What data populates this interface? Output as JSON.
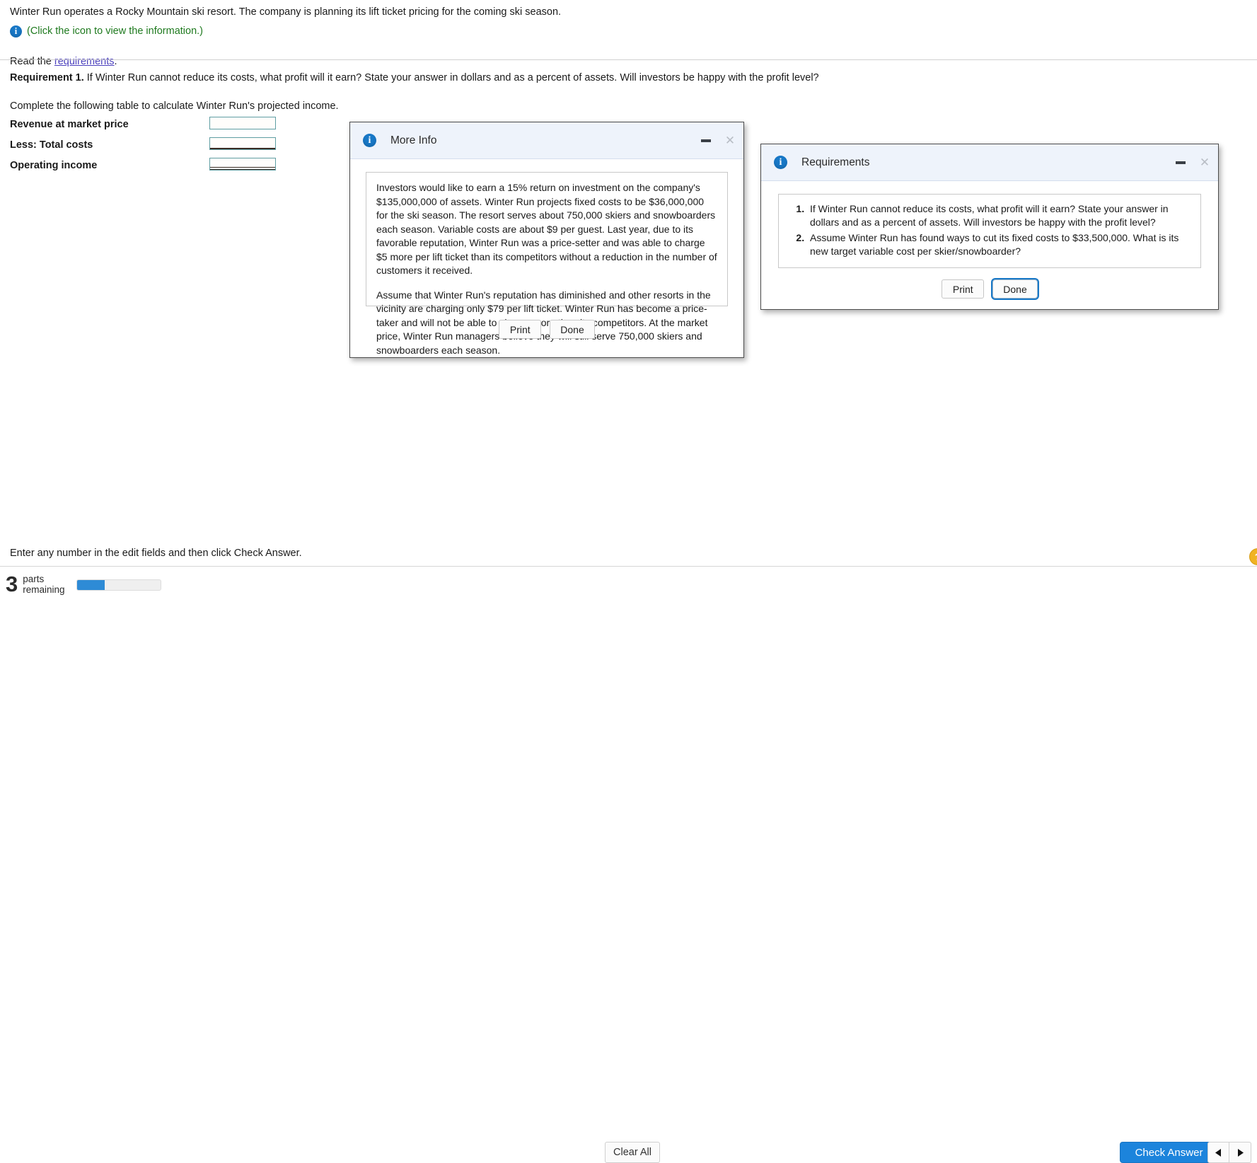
{
  "intro": {
    "sentence": "Winter Run operates a Rocky Mountain ski resort. The company is planning its lift ticket pricing for the coming ski season.",
    "info_icon": "info-icon",
    "info_click_text": "(Click the icon to view the information.)",
    "read_prefix": "Read the ",
    "read_link": "requirements",
    "read_suffix": "."
  },
  "requirement": {
    "label": "Requirement 1.",
    "text": "If Winter Run cannot reduce its costs, what profit will it earn? State your answer in dollars and as a percent of assets. Will investors be happy with the profit level?",
    "instruction": "Complete the following table to calculate Winter Run's projected income."
  },
  "answer_table": {
    "rows": [
      {
        "label": "Revenue at market price",
        "value": "",
        "rule": "none"
      },
      {
        "label": "Less: Total costs",
        "value": "",
        "rule": "single"
      },
      {
        "label": "Operating income",
        "value": "",
        "rule": "double"
      }
    ]
  },
  "more_info_dialog": {
    "title": "More Info",
    "icon": "info-icon",
    "minimize_icon": "minimize-icon",
    "close_icon": "close-icon",
    "paragraphs": [
      "Investors would like to earn a 15% return on investment on the company's $135,000,000 of assets. Winter Run projects fixed costs to be $36,000,000 for the ski season. The resort serves about 750,000 skiers and snowboarders each season. Variable costs are about $9 per guest. Last year, due to its favorable reputation, Winter Run was a price-setter and was able to charge $5 more per lift ticket than its competitors without a reduction in the number of customers it received.",
      "Assume that Winter Run's reputation has diminished and other resorts in the vicinity are charging only $79 per lift ticket. Winter Run has become a price-taker and will not be able to charge more than its competitors. At the market price, Winter Run managers believe they will still serve 750,000 skiers and snowboarders each season."
    ],
    "print_label": "Print",
    "done_label": "Done"
  },
  "requirements_dialog": {
    "title": "Requirements",
    "icon": "info-icon",
    "minimize_icon": "minimize-icon",
    "close_icon": "close-icon",
    "items": [
      "If Winter Run cannot reduce its costs, what profit will it earn? State your answer in dollars and as a percent of assets. Will investors be happy with the profit level?",
      "Assume Winter Run has found ways to cut its fixed costs to $33,500,000. What is its new target variable cost per skier/snowboarder?"
    ],
    "print_label": "Print",
    "done_label": "Done"
  },
  "bottom": {
    "hint": "Enter any number in the edit fields and then click Check Answer.",
    "parts_count": "3",
    "parts_word_line1": "parts",
    "parts_word_line2": "remaining",
    "progress_percent": 33,
    "clear_all_label": "Clear All",
    "check_answer_label": "Check Answer",
    "prev_icon": "caret-left-icon",
    "next_icon": "caret-right-icon",
    "help_icon": "help-icon",
    "help_glyph": "?"
  },
  "colors": {
    "accent_blue": "#1c84dc",
    "info_blue": "#1878c7",
    "link_purple": "#4a3fbd",
    "green_text": "#1f7a1f",
    "input_border": "#5f9ea3",
    "dialog_header_bg": "#eef3fb"
  }
}
